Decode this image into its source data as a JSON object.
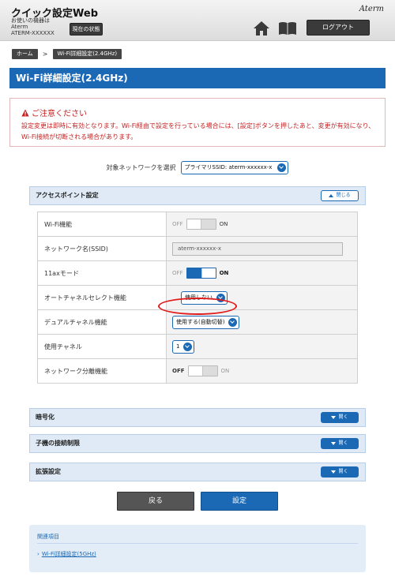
{
  "header": {
    "app_title": "クイック設定Web",
    "device_label": "お使いの機器は",
    "device_name": "Aterm",
    "device_model": "ATERM-XXXXXX",
    "status_button": "現在の状態",
    "brand": "Aterm",
    "logout_button": "ログアウト"
  },
  "breadcrumb": {
    "home": "ホーム",
    "separator": ">",
    "current": "Wi-Fi詳細設定(2.4GHz)"
  },
  "page_title": "Wi-Fi詳細設定(2.4GHz)",
  "notice": {
    "title": "ご注意ください",
    "text": "設定変更は即時に有効となります。Wi-Fi経由で設定を行っている場合には、[設定]ボタンを押したあと、変更が有効になり、Wi-Fi接続が切断される場合があります。"
  },
  "network_select": {
    "label": "対象ネットワークを選択",
    "value": "プライマリSSID: aterm-xxxxxx-x"
  },
  "sections": {
    "access_point": {
      "title": "アクセスポイント設定",
      "toggle": "閉じる"
    },
    "encryption": {
      "title": "暗号化",
      "toggle": "開く"
    },
    "client_restriction": {
      "title": "子機の接続制限",
      "toggle": "開く"
    },
    "advanced": {
      "title": "拡張設定",
      "toggle": "開く"
    }
  },
  "ap_rows": {
    "wifi_function": {
      "label": "Wi-Fi機能",
      "off": "OFF",
      "on": "ON",
      "state": "off"
    },
    "ssid": {
      "label": "ネットワーク名(SSID)",
      "value": "aterm-xxxxxx-x"
    },
    "ax_mode": {
      "label": "11axモード",
      "off": "OFF",
      "on": "ON",
      "state": "on"
    },
    "auto_channel": {
      "label": "オートチャネルセレクト機能",
      "value": "使用しない"
    },
    "dual_channel": {
      "label": "デュアルチャネル機能",
      "value": "使用する(自動切替)"
    },
    "channel": {
      "label": "使用チャネル",
      "value": "1"
    },
    "network_separation": {
      "label": "ネットワーク分離機能",
      "off": "OFF",
      "on": "ON",
      "state": "off"
    }
  },
  "buttons": {
    "back": "戻る",
    "apply": "設定"
  },
  "related": {
    "title": "関連項目",
    "link": "Wi-Fi詳細設定(5GHz)",
    "bullet": "›"
  },
  "colors": {
    "accent": "#1b68b5",
    "warning": "#c42222",
    "highlight": "#e11b1b"
  }
}
